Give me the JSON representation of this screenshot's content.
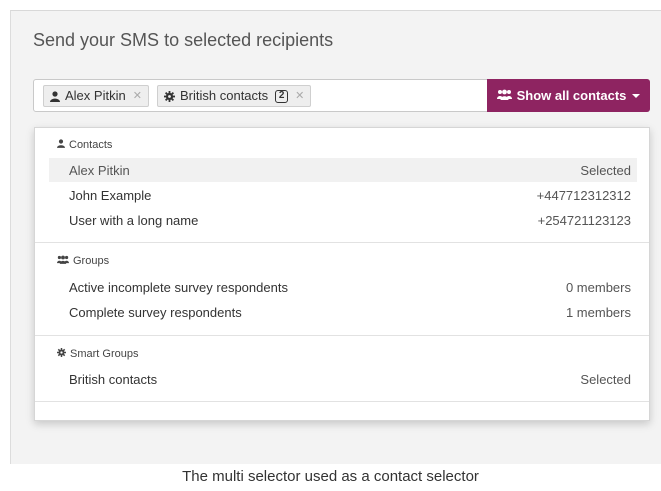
{
  "heading": "Send your SMS to selected recipients",
  "tokens": [
    {
      "label": "Alex Pitkin",
      "icon": "user-icon"
    },
    {
      "label": "British contacts",
      "icon": "gear-icon",
      "badge": "2"
    }
  ],
  "show_button": {
    "label": "Show all contacts",
    "icon": "users-icon"
  },
  "groups": {
    "contacts": {
      "title": "Contacts",
      "icon": "user-icon",
      "items": [
        {
          "name": "Alex Pitkin",
          "meta": "Selected"
        },
        {
          "name": "John Example",
          "meta": "+447712312312"
        },
        {
          "name": "User with a long name",
          "meta": "+254721123123"
        }
      ]
    },
    "groups": {
      "title": "Groups",
      "icon": "users-icon",
      "items": [
        {
          "name": "Active incomplete survey respondents",
          "meta": "0 members"
        },
        {
          "name": "Complete survey respondents",
          "meta": "1 members"
        }
      ]
    },
    "smart": {
      "title": "Smart Groups",
      "icon": "gear-icon",
      "items": [
        {
          "name": "British contacts",
          "meta": "Selected"
        }
      ]
    }
  },
  "caption": "The multi selector used as a contact selector",
  "colors": {
    "accent": "#8e2461",
    "selected_row": "#f1f1f1"
  }
}
